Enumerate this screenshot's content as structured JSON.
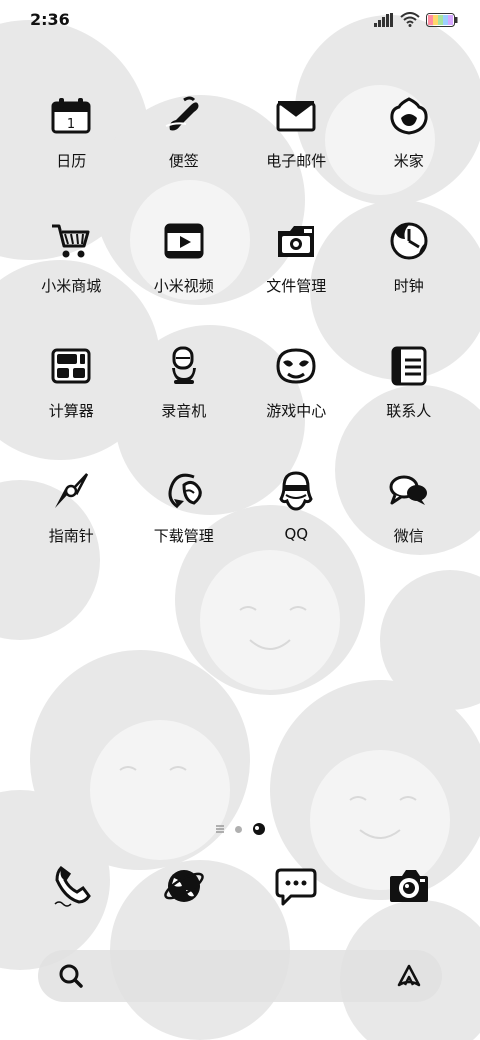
{
  "status_bar": {
    "time": "2:36"
  },
  "apps": [
    {
      "label": "日历",
      "icon": "calendar-icon"
    },
    {
      "label": "便签",
      "icon": "notes-icon"
    },
    {
      "label": "电子邮件",
      "icon": "email-icon"
    },
    {
      "label": "米家",
      "icon": "mijia-icon"
    },
    {
      "label": "小米商城",
      "icon": "shopping-cart-icon"
    },
    {
      "label": "小米视频",
      "icon": "video-icon"
    },
    {
      "label": "文件管理",
      "icon": "file-manager-icon"
    },
    {
      "label": "时钟",
      "icon": "clock-icon"
    },
    {
      "label": "计算器",
      "icon": "calculator-icon"
    },
    {
      "label": "录音机",
      "icon": "recorder-icon"
    },
    {
      "label": "游戏中心",
      "icon": "game-center-icon"
    },
    {
      "label": "联系人",
      "icon": "contacts-icon"
    },
    {
      "label": "指南针",
      "icon": "compass-icon"
    },
    {
      "label": "下载管理",
      "icon": "download-icon"
    },
    {
      "label": "QQ",
      "icon": "qq-icon"
    },
    {
      "label": "微信",
      "icon": "wechat-icon"
    }
  ],
  "calendar_day": "1",
  "dock": [
    {
      "icon": "phone-icon"
    },
    {
      "icon": "browser-icon"
    },
    {
      "icon": "messages-icon"
    },
    {
      "icon": "camera-icon"
    }
  ],
  "pager": {
    "pages": 3,
    "current": 3
  },
  "colors": {
    "icon": "#111111",
    "wallpaper": "#e6e6e6",
    "search_bg": "#e1e1e1"
  }
}
